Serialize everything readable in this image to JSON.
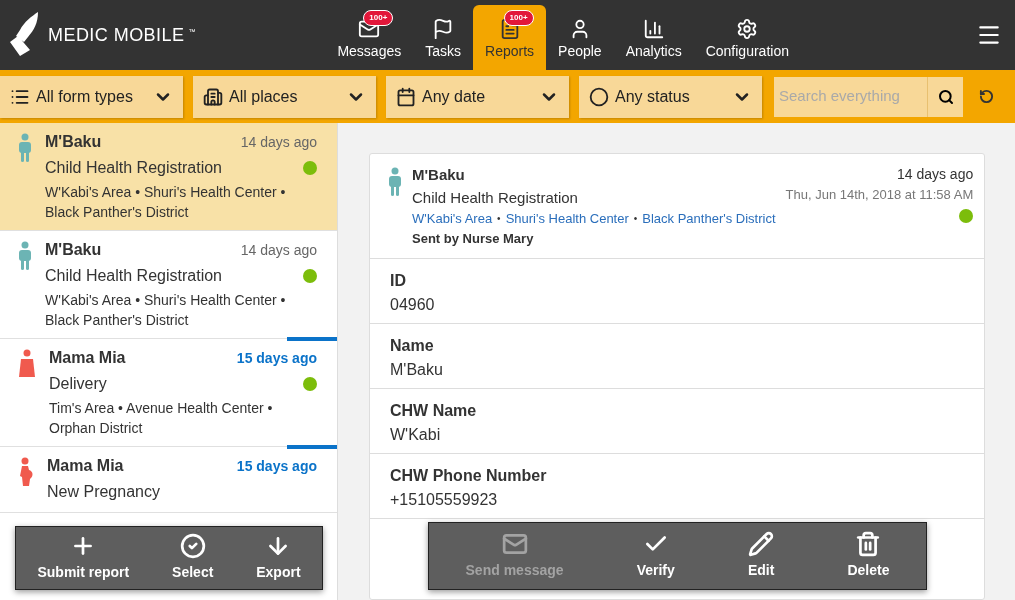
{
  "brand": {
    "name": "MEDIC MOBILE",
    "mark": "™"
  },
  "nav": [
    {
      "label": "Messages",
      "badge": "100+",
      "selected": false
    },
    {
      "label": "Tasks",
      "selected": false
    },
    {
      "label": "Reports",
      "badge": "100+",
      "selected": true
    },
    {
      "label": "People",
      "selected": false
    },
    {
      "label": "Analytics",
      "selected": false
    },
    {
      "label": "Configuration",
      "selected": false
    }
  ],
  "filters": [
    {
      "label": "All form types"
    },
    {
      "label": "All places"
    },
    {
      "label": "Any date"
    },
    {
      "label": "Any status"
    }
  ],
  "search": {
    "placeholder": "Search everything"
  },
  "reports": [
    {
      "name": "M'Baku",
      "form": "Child Health Registration",
      "place": "W'Kabi's Area • Shuri's Health Center • Black Panther's District",
      "time": "14 days ago",
      "kind": "child",
      "unread": false,
      "selected": true,
      "color": "#7cbd0b"
    },
    {
      "name": "M'Baku",
      "form": "Child Health Registration",
      "place": "W'Kabi's Area • Shuri's Health Center • Black Panther's District",
      "time": "14 days ago",
      "kind": "child",
      "unread": false,
      "selected": false,
      "color": "#7cbd0b"
    },
    {
      "name": "Mama Mia",
      "form": "Delivery",
      "place": "Tim's Area • Avenue Health Center • Orphan District",
      "time": "15 days ago",
      "kind": "mother",
      "unread": true,
      "selected": false,
      "color": "#7cbd0b"
    },
    {
      "name": "Mama Mia",
      "form": "New Pregnancy",
      "time": "15 days ago",
      "kind": "pregnant",
      "unread": true,
      "selected": false
    }
  ],
  "detail": {
    "name": "M'Baku",
    "form": "Child Health Registration",
    "places": [
      "W'Kabi's Area",
      "Shuri's Health Center",
      "Black Panther's District"
    ],
    "separator": "•",
    "sent_by": "Sent by Nurse Mary",
    "time": "14 days ago",
    "date": "Thu, Jun 14th, 2018 at 11:58 AM",
    "color": "#7cbd0b",
    "fields": [
      {
        "label": "ID",
        "value": "04960"
      },
      {
        "label": "Name",
        "value": "M'Baku"
      },
      {
        "label": "CHW Name",
        "value": "W'Kabi"
      },
      {
        "label": "CHW Phone Number",
        "value": "+15105559923"
      }
    ]
  },
  "list_actions": [
    {
      "label": "Submit report",
      "disabled": false
    },
    {
      "label": "Select",
      "disabled": false
    },
    {
      "label": "Export",
      "disabled": false
    }
  ],
  "detail_actions": [
    {
      "label": "Send message",
      "disabled": true
    },
    {
      "label": "Verify",
      "disabled": false
    },
    {
      "label": "Edit",
      "disabled": false
    },
    {
      "label": "Delete",
      "disabled": false
    }
  ]
}
